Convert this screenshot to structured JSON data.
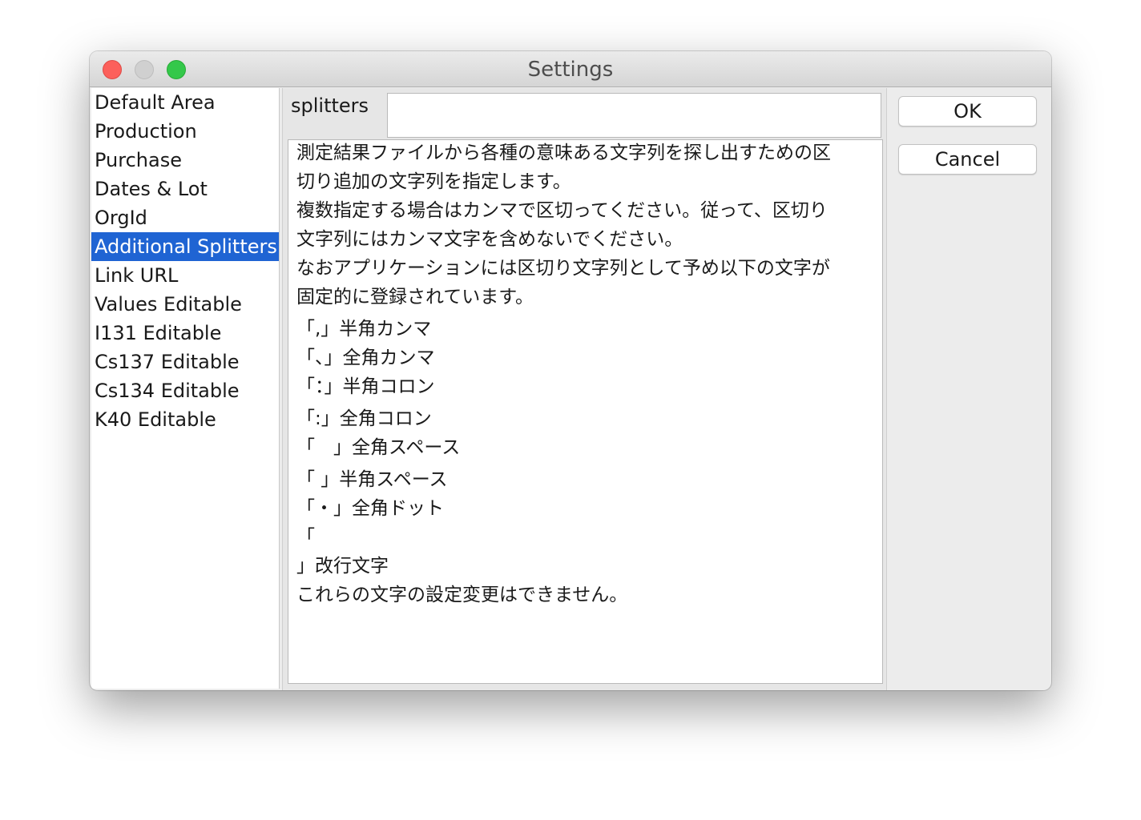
{
  "window": {
    "title": "Settings"
  },
  "sidebar": {
    "items": [
      {
        "label": "Default Area"
      },
      {
        "label": "Production"
      },
      {
        "label": "Purchase"
      },
      {
        "label": "Dates & Lot"
      },
      {
        "label": "OrgId"
      },
      {
        "label": "Additional Splitters",
        "selected": true
      },
      {
        "label": "Link URL"
      },
      {
        "label": "Values Editable"
      },
      {
        "label": "I131 Editable"
      },
      {
        "label": "Cs137 Editable"
      },
      {
        "label": "Cs134 Editable"
      },
      {
        "label": "K40 Editable"
      }
    ]
  },
  "main": {
    "splitters_label": "splitters",
    "splitters_value": "",
    "description_lines": [
      "測定結果ファイルから各種の意味ある文字列を探し出すための区",
      "切り追加の文字列を指定します。",
      "複数指定する場合はカンマで区切ってください。従って、区切り",
      "文字列にはカンマ文字を含めないでください。",
      "なおアプリケーションには区切り文字列として予め以下の文字が",
      "固定的に登録されています。",
      "「,」半角カンマ",
      "「、」全角カンマ",
      "「：」半角コロン",
      "「:」全角コロン",
      "「　」全角スペース",
      "「 」半角スペース",
      "「・」全角ドット",
      "「",
      "」改行文字",
      "これらの文字の設定変更はできません。"
    ]
  },
  "buttons": {
    "ok": "OK",
    "cancel": "Cancel"
  },
  "colors": {
    "selection": "#1f64d3",
    "close": "#fc605b",
    "maximize": "#34c84a",
    "minimize_inactive": "#d0d0d0"
  }
}
